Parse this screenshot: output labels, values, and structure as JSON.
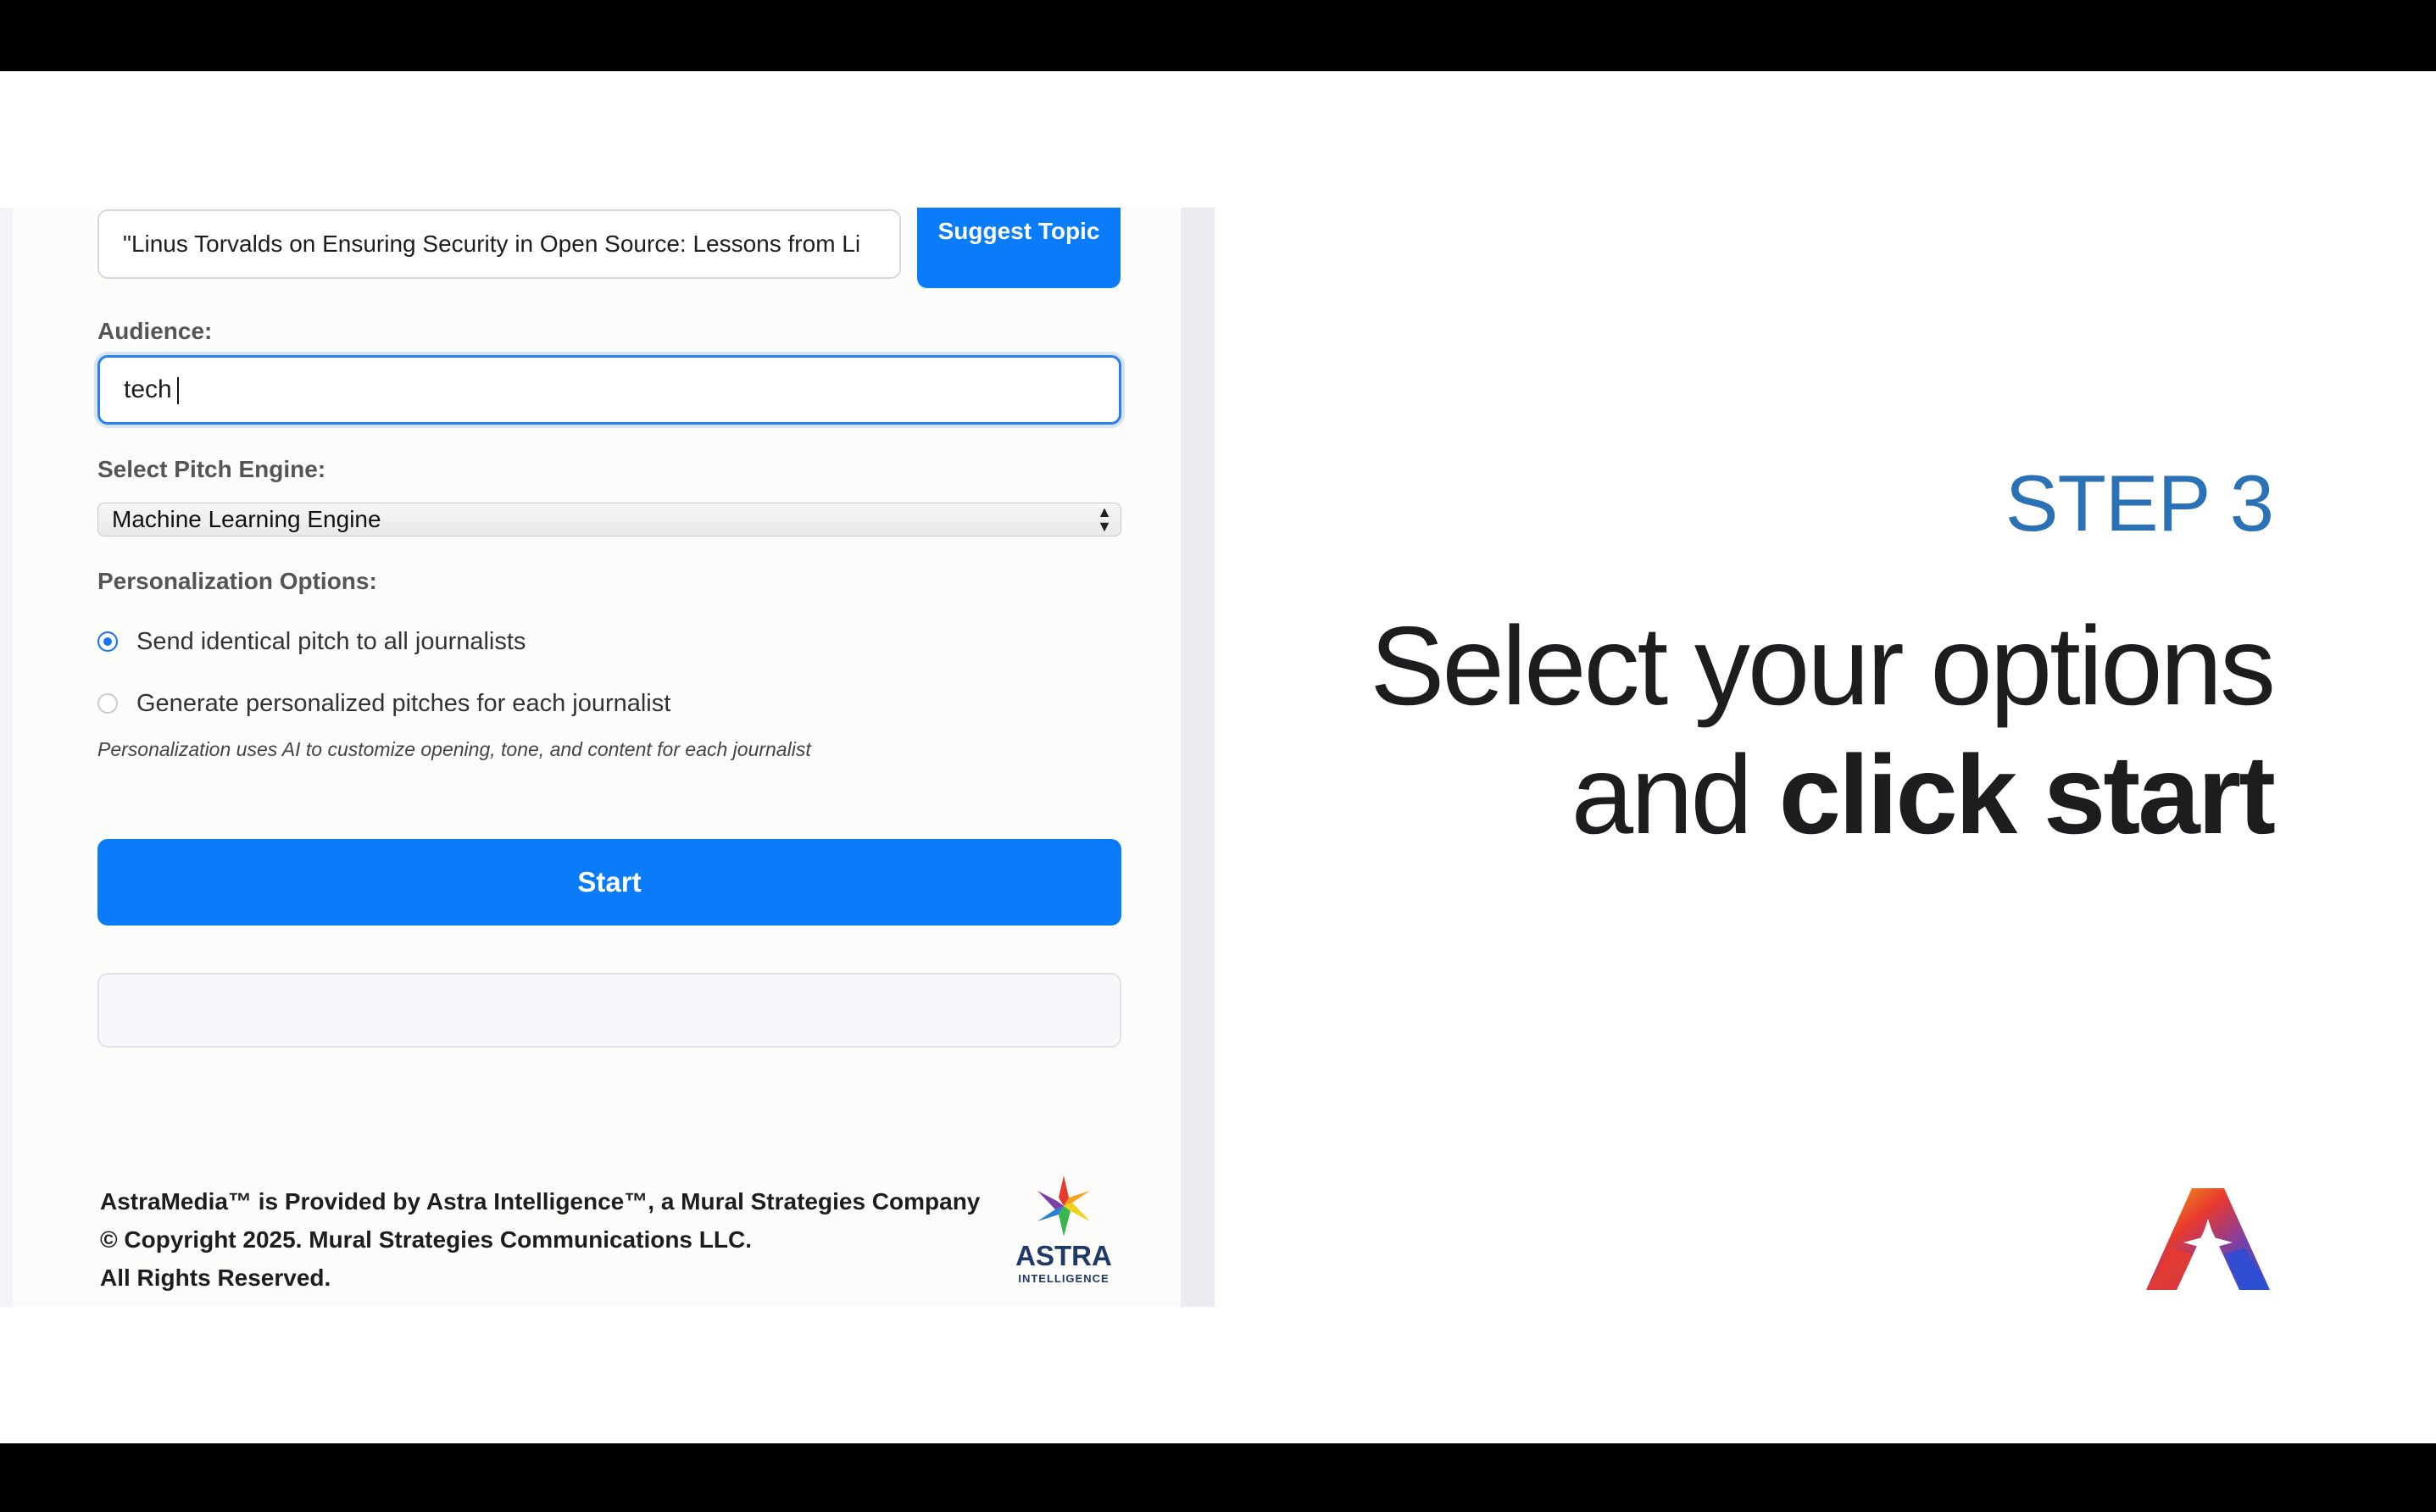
{
  "form": {
    "topic_value": "\"Linus Torvalds on Ensuring Security in Open Source: Lessons from Li",
    "suggest_topic_label": "Suggest Topic",
    "audience_label": "Audience:",
    "audience_value": "tech",
    "engine_label": "Select Pitch Engine:",
    "engine_selected": "Machine Learning Engine",
    "personalization_label": "Personalization Options:",
    "option_identical": "Send identical pitch to all journalists",
    "option_personalized": "Generate personalized pitches for each journalist",
    "selected_option": "identical",
    "personalization_note": "Personalization uses AI to customize opening, tone, and content for each journalist",
    "start_label": "Start"
  },
  "footer": {
    "line1": "AstraMedia™ is Provided by Astra Intelligence™, a Mural Strategies Company",
    "line2": "© Copyright 2025. Mural Strategies Communications LLC.",
    "line3": "All Rights Reserved.",
    "logo_word": "ASTRA",
    "logo_sub": "INTELLIGENCE"
  },
  "slide": {
    "step": "STEP 3",
    "headline_line1": "Select your options",
    "headline_line2_regular": "and ",
    "headline_line2_bold": "click start"
  },
  "colors": {
    "accent": "#0a7cf9",
    "step": "#2a71b6"
  }
}
